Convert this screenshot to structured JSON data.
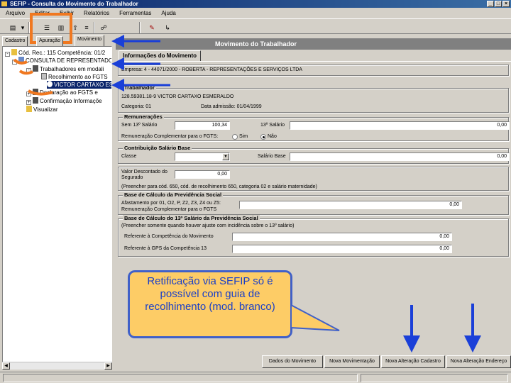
{
  "window": {
    "title": "SEFIP - Consulta do Movimento do Trabalhador",
    "controls": [
      "_",
      "□",
      "×"
    ]
  },
  "menu": [
    "Arquivo",
    "Editar",
    "Exibir",
    "Relatórios",
    "Ferramentas",
    "Ajuda"
  ],
  "toolbar": {
    "buttons": [
      {
        "name": "properties-icon",
        "glyph": "▤"
      },
      {
        "name": "dropdown-icon",
        "glyph": "▾"
      },
      {
        "name": "view-list-icon",
        "glyph": "☰"
      },
      {
        "name": "view-details-icon",
        "glyph": "▥"
      },
      {
        "name": "export-icon",
        "glyph": "⇪"
      },
      {
        "name": "list-icon",
        "glyph": "≡"
      },
      {
        "name": "binoculars-icon",
        "glyph": "☍"
      },
      {
        "name": "bookmark-icon",
        "glyph": "✎"
      },
      {
        "name": "exit-icon",
        "glyph": "↳"
      }
    ]
  },
  "left_tabs": [
    "Cadastro",
    "Apuração",
    "Movimento"
  ],
  "tree": [
    {
      "text": "Cód. Rec.: 115 Competência: 01/2",
      "level": 0,
      "toggle": "-",
      "icon": "folder"
    },
    {
      "text": "CONSULTA DE REPRESENTADO",
      "level": 1,
      "toggle": "-",
      "icon": "company"
    },
    {
      "text": "Trabalhadores em modali",
      "level": 2,
      "toggle": "-",
      "icon": "folder"
    },
    {
      "text": "Recolhimento ao FGTS",
      "level": 3,
      "toggle": "",
      "icon": "doc"
    },
    {
      "text": "VICTOR CARTAXO ESME",
      "level": 4,
      "toggle": "",
      "icon": "person"
    },
    {
      "text": "Declaração ao FGTS e",
      "level": 2,
      "toggle": "+",
      "icon": "doc"
    },
    {
      "text": "Confirmação Informaçõe",
      "level": 2,
      "toggle": "+",
      "icon": "doc"
    },
    {
      "text": "Visualizar",
      "level": 0,
      "toggle": "",
      "icon": "folder"
    }
  ],
  "right": {
    "header": "Movimento do Trabalhador",
    "tab": "Informações do Movimento",
    "empresa": "Empresa: 4 - 44071/2000 - ROBERTA - REPRESENTAÇÕES E SERVIÇOS LTDA",
    "trabalhador_title": "Trabalhador",
    "trabalhador": "128.59381.18-9  VICTOR CARTAXO ESMERALDO",
    "categoria": "Categoria: 01",
    "admissao": "Data admissão: 01/04/1999",
    "remuneracoes": {
      "title": "Remunerações",
      "sem13_label": "Sem 13º Salário",
      "sem13_value": "100,34",
      "sal13_label": "13º Salário",
      "sal13_value": "0,00",
      "compl_label": "Remuneração Complementar para o FGTS:",
      "sim": "Sim",
      "nao": "Não",
      "selected": "nao"
    },
    "contribuicao": {
      "title": "Contribuição Salário Base",
      "classe_label": "Classe",
      "classe_value": "",
      "salario_label": "Salário Base",
      "salario_value": "0,00"
    },
    "valor_desc_label": "Valor Descontado do Segurado",
    "valor_desc_value": "0,00",
    "preencher_note": "(Preencher para cód. 650, cód. de recolhimento 650, categoria 02 e salário maternidade)",
    "base_prev": {
      "title": "Base de Cálculo da Previdência Social",
      "line1": "Afastamento por 01, O2, P, Z2, Z3, Z4 ou Z5:",
      "line2": "Remuneração Complementar para o FGTS",
      "value": "0,00"
    },
    "base_13": {
      "title": "Base de Cálculo do 13º Salário da Previdência Social",
      "note": "(Preencher somente quando houver ajuste com incidência sobre o 13º salário)",
      "ref_comp_label": "Referente à Competência do Movimento",
      "ref_comp_value": "0,00",
      "ref_gps_label": "Referente à GPS da Competência 13",
      "ref_gps_value": "0,00"
    }
  },
  "buttons": [
    "Dados do Movimento",
    "Nova Movimentação",
    "Nova Alteração Cadastro",
    "Nova Alteração Endereço"
  ],
  "callout": "Retificação via SEFIP só é possível com guia de recolhimento (mod. branco)",
  "colors": {
    "arrow": "#1a3fd8",
    "highlight": "#f07820",
    "callout_bg": "#fdcc66"
  }
}
